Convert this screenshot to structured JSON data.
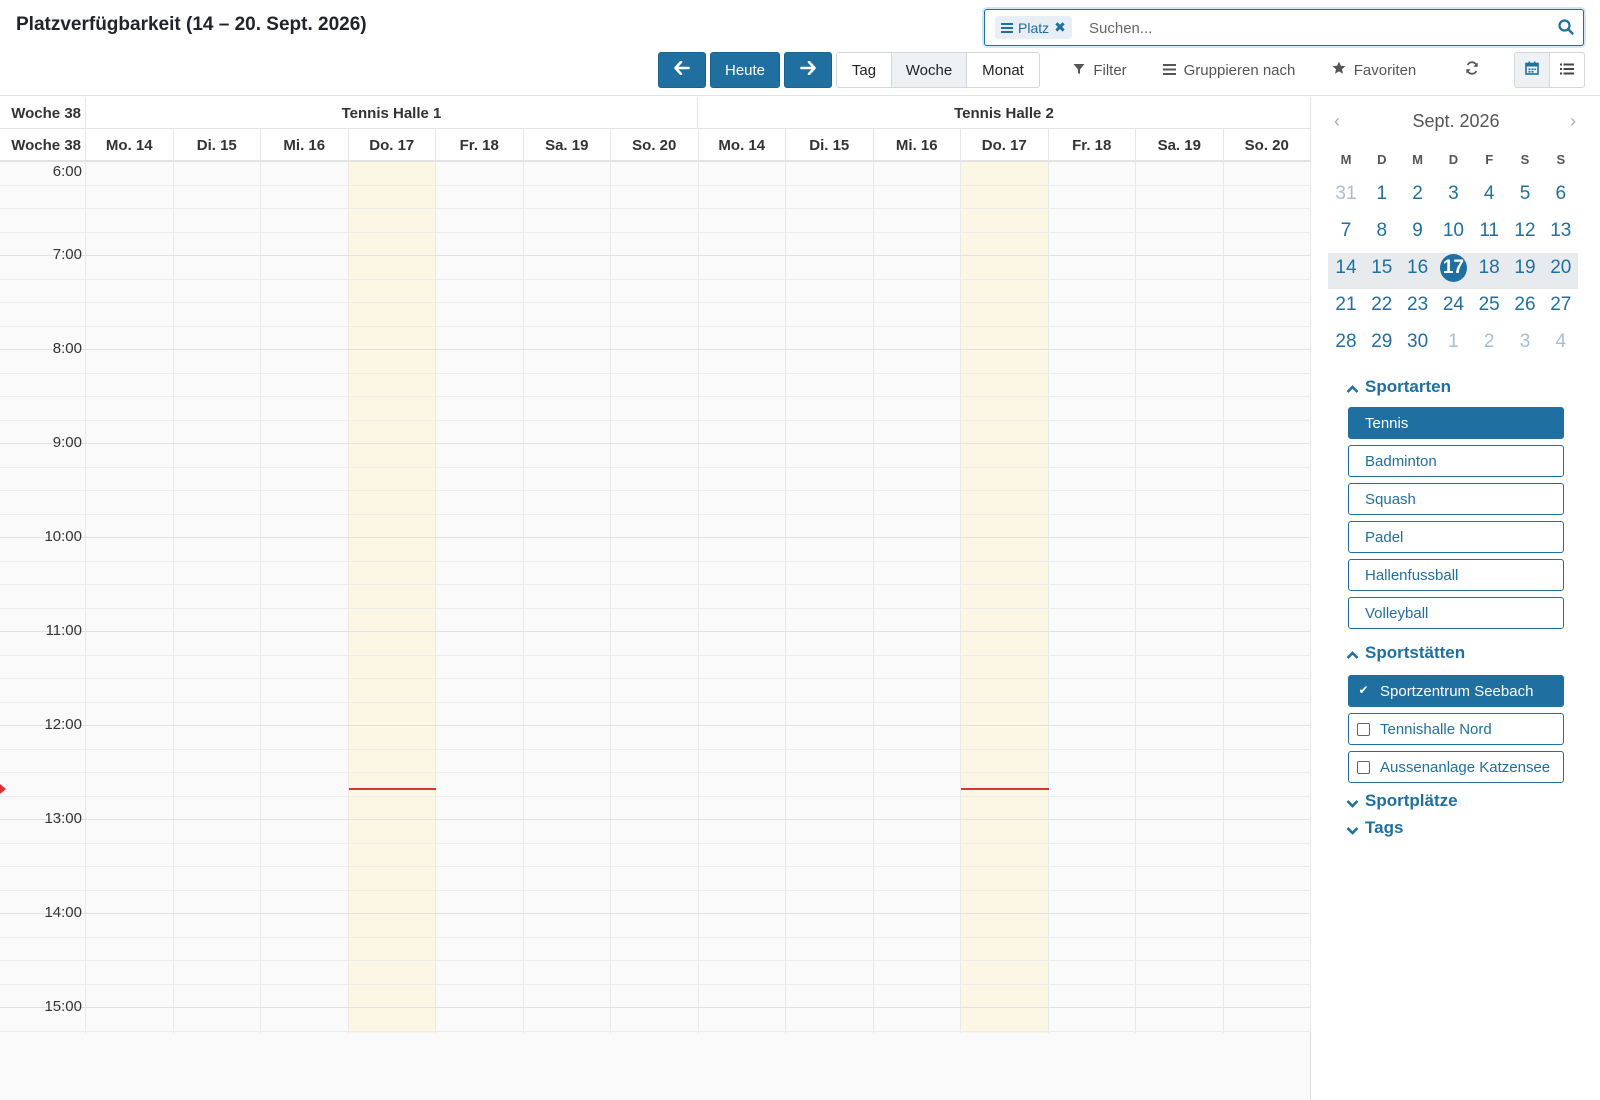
{
  "header": {
    "title": "Platzverfügbarkeit (14 – 20. Sept. 2026)",
    "search": {
      "facet_label": "Platz",
      "placeholder": "Suchen..."
    }
  },
  "toolbar": {
    "today_label": "Heute",
    "views": [
      "Tag",
      "Woche",
      "Monat"
    ],
    "active_view": "Woche",
    "filter_label": "Filter",
    "group_label": "Gruppieren nach",
    "favorites_label": "Favoriten"
  },
  "calendar": {
    "week_label": "Woche 38",
    "resources": [
      "Tennis Halle 1",
      "Tennis Halle 2"
    ],
    "days": [
      "Mo. 14",
      "Di. 15",
      "Mi. 16",
      "Do. 17",
      "Fr. 18",
      "Sa. 19",
      "So. 20"
    ],
    "today_index": 3,
    "hours": [
      "6:00",
      "7:00",
      "8:00",
      "9:00",
      "10:00",
      "11:00",
      "12:00",
      "13:00",
      "14:00",
      "15:00"
    ],
    "now_time": "12:40"
  },
  "sidebar": {
    "mini_calendar": {
      "month_label": "Sept. 2026",
      "weekdays": [
        "M",
        "D",
        "M",
        "D",
        "F",
        "S",
        "S"
      ],
      "weeks": [
        [
          "31",
          "1",
          "2",
          "3",
          "4",
          "5",
          "6"
        ],
        [
          "7",
          "8",
          "9",
          "10",
          "11",
          "12",
          "13"
        ],
        [
          "14",
          "15",
          "16",
          "17",
          "18",
          "19",
          "20"
        ],
        [
          "21",
          "22",
          "23",
          "24",
          "25",
          "26",
          "27"
        ],
        [
          "28",
          "29",
          "30",
          "1",
          "2",
          "3",
          "4"
        ]
      ],
      "selected_day": "17"
    },
    "sections": {
      "sports": {
        "title": "Sportarten",
        "items": [
          "Tennis",
          "Badminton",
          "Squash",
          "Padel",
          "Hallenfussball",
          "Volleyball"
        ],
        "active": "Tennis"
      },
      "venues": {
        "title": "Sportstätten",
        "items": [
          "Sportzentrum Seebach",
          "Tennishalle Nord",
          "Aussenanlage Katzensee"
        ],
        "checked": "Sportzentrum Seebach"
      },
      "courts": {
        "title": "Sportplätze"
      },
      "tags": {
        "title": "Tags"
      }
    }
  },
  "colors": {
    "accent": "#1f6fa0",
    "today": "#fcf6e4",
    "now_line": "#e03131"
  }
}
